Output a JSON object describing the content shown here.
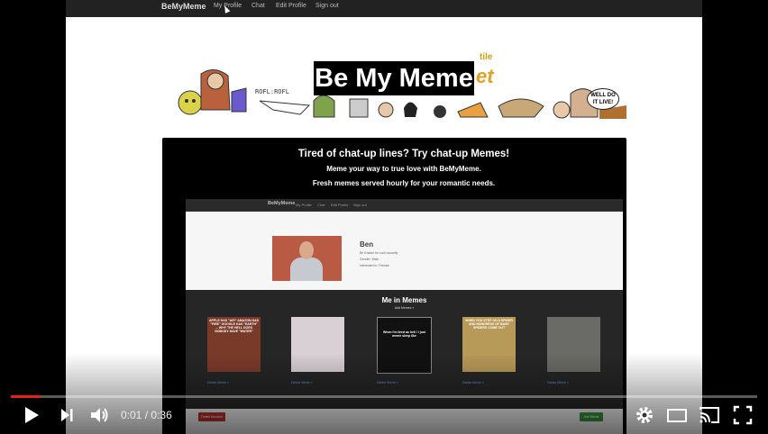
{
  "site_nav": {
    "brand": "BeMyMeme",
    "items": [
      "My Profile",
      "Chat",
      "Edit Profile",
      "Sign out"
    ]
  },
  "banner": {
    "title": "Be My Meme",
    "overlap_text": "et",
    "tile_text": "tile",
    "bubble_text": "WELL DO IT LIVE!"
  },
  "video": {
    "headline": "Tired of chat-up lines? Try chat-up Memes!",
    "subline1": "Meme your way to true love with BeMyMeme.",
    "subline2": "Fresh memes served hourly for your romantic needs.",
    "inner_nav": {
      "brand": "BeMyMeme",
      "items": [
        "My Profile",
        "Chat",
        "Edit Profile",
        "Sign out"
      ]
    },
    "profile": {
      "name": "Ben",
      "line1": "Be Khalan be cuol vacantly",
      "line2": "Gender: Male",
      "line3": "Interested in: Female"
    },
    "memes_title": "Me in Memes",
    "add_memes": "Add Memes »",
    "memes": [
      {
        "caption": "APPLE HAS \"AIR\" AMAZON HAS \"FIRE\" GOOGLE HAS \"EARTH\" ... WHY THE HELL DOES NOBODY HAVE \"WATER\"",
        "link": "Delete Meme »"
      },
      {
        "caption": "",
        "link": "Delete Meme »"
      },
      {
        "caption": "When I'm tired as hell / I just meme sleep like",
        "link": "Delete Meme »"
      },
      {
        "caption": "WHEN YOU STEP ON A SPIDER AND HUNDREDS OF BABY SPIDERS COME OUT",
        "link": "Delete Meme »"
      },
      {
        "caption": "",
        "link": "Delete Meme »"
      }
    ],
    "delete_account": "Delete Account",
    "save_button": "Add Meme"
  },
  "player": {
    "current_time": "0:01",
    "duration": "0:36",
    "time_separator": "/",
    "progress_fraction": 0.04
  }
}
